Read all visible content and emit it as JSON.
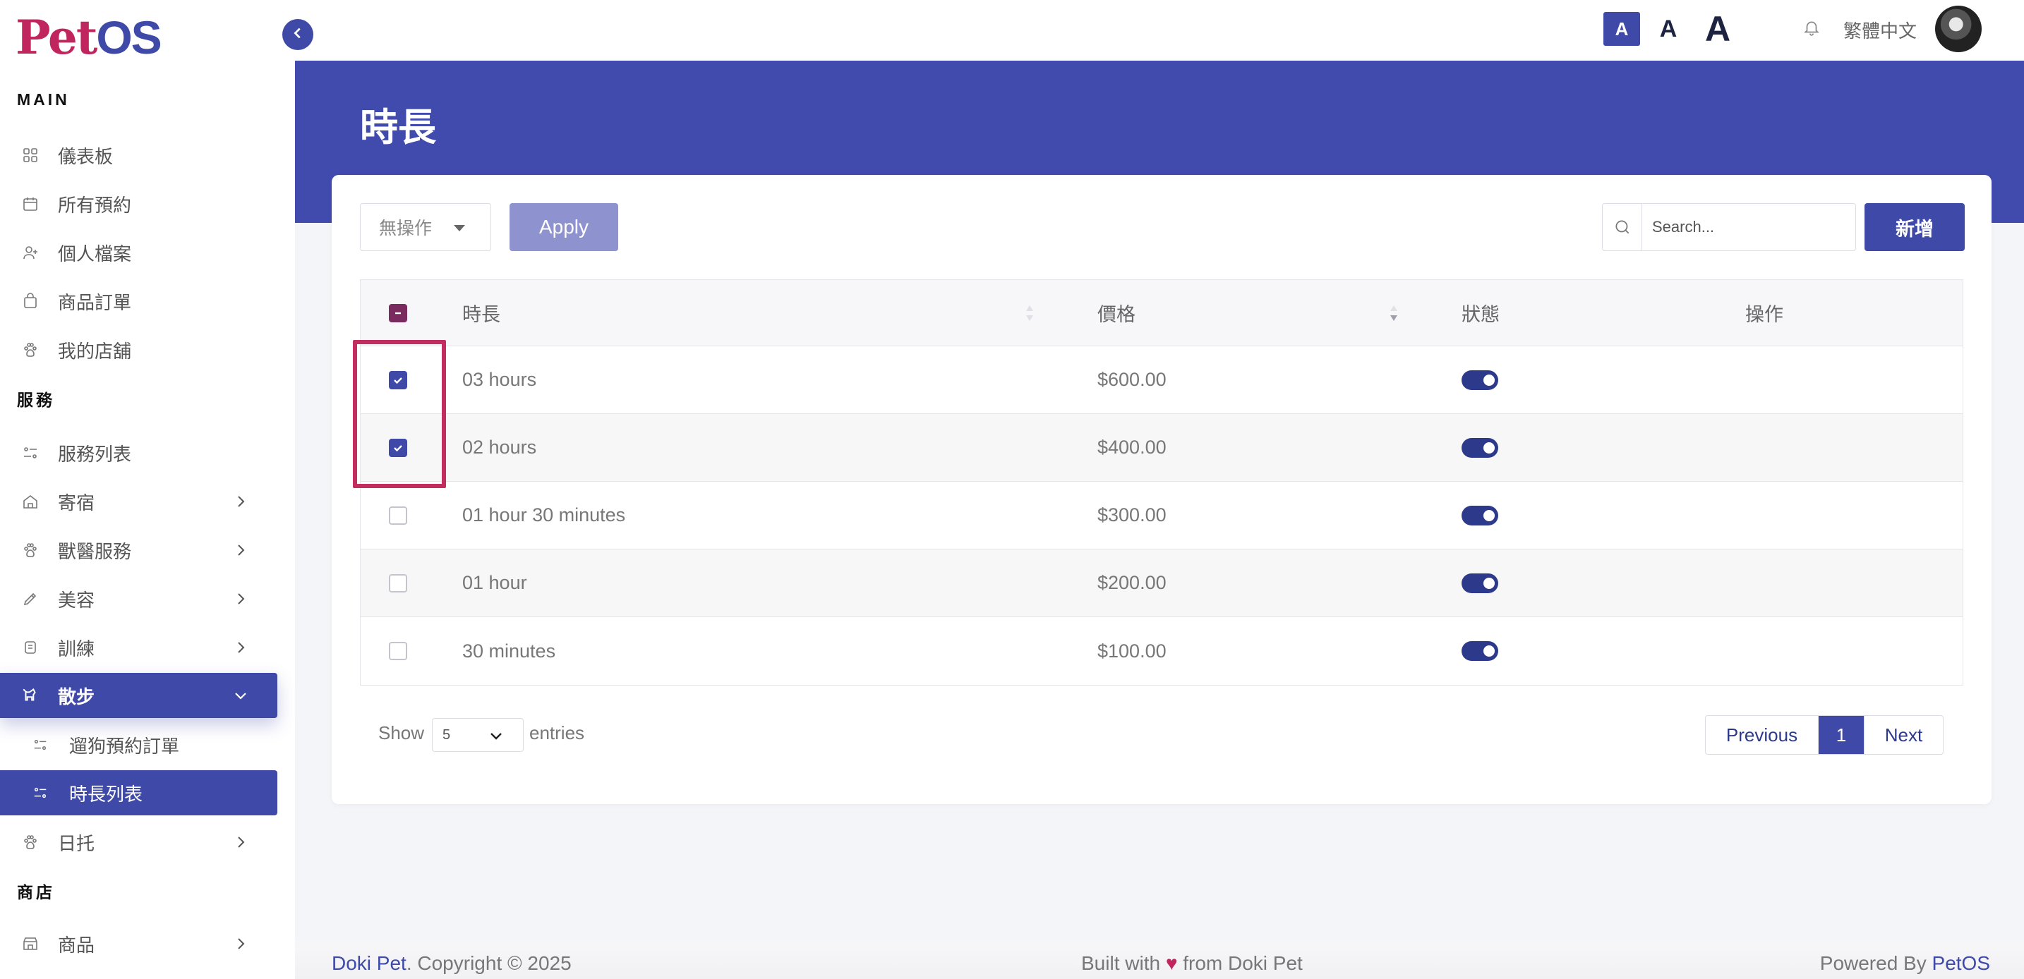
{
  "sidebar": {
    "logo": {
      "part1": "Pet",
      "part2": "OS"
    },
    "sections": {
      "main": "MAIN",
      "services": "服務",
      "shop": "商店"
    },
    "items": {
      "dashboard": "儀表板",
      "appointments": "所有預約",
      "profile": "個人檔案",
      "orders": "商品訂單",
      "my_store": "我的店舖",
      "service_list": "服務列表",
      "boarding": "寄宿",
      "vet": "獸醫服務",
      "grooming": "美容",
      "training": "訓練",
      "walking": "散步",
      "walk_orders": "遛狗預約訂單",
      "duration_list": "時長列表",
      "daycare": "日托",
      "products": "商品"
    }
  },
  "header": {
    "font_small": "A",
    "font_medium": "A",
    "font_large": "A",
    "language": "繁體中文"
  },
  "page": {
    "title": "時長"
  },
  "toolbar": {
    "action_select": "無操作",
    "apply_label": "Apply",
    "search_placeholder": "Search...",
    "add_label": "新增"
  },
  "table": {
    "headers": {
      "duration": "時長",
      "price": "價格",
      "status": "狀態",
      "action": "操作"
    },
    "rows": [
      {
        "duration": "03 hours",
        "price": "$600.00",
        "checked": true,
        "status_on": true
      },
      {
        "duration": "02 hours",
        "price": "$400.00",
        "checked": true,
        "status_on": true
      },
      {
        "duration": "01 hour 30 minutes",
        "price": "$300.00",
        "checked": false,
        "status_on": true
      },
      {
        "duration": "01 hour",
        "price": "$200.00",
        "checked": false,
        "status_on": true
      },
      {
        "duration": "30 minutes",
        "price": "$100.00",
        "checked": false,
        "status_on": true
      }
    ]
  },
  "pagination": {
    "show_label": "Show",
    "entries_value": "5",
    "entries_label": "entries",
    "previous": "Previous",
    "current_page": "1",
    "next": "Next"
  },
  "footer": {
    "brand": "Doki Pet",
    "copyright": ". Copyright © 2025",
    "built_prefix": "Built with",
    "built_suffix": "from Doki Pet",
    "powered_prefix": "Powered By",
    "powered_brand": "PetOS"
  },
  "colors": {
    "primary": "#3f4aa8",
    "accent": "#c0265d"
  }
}
